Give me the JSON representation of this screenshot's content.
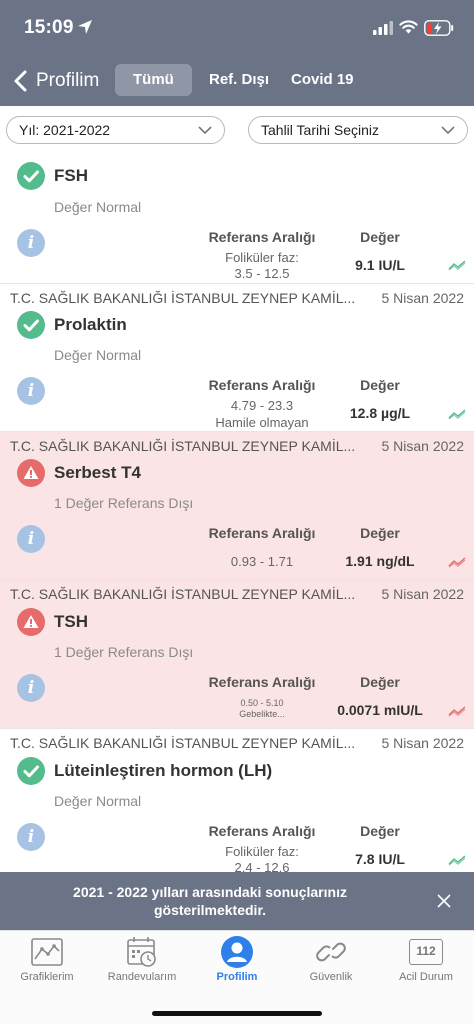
{
  "status_bar": {
    "time": "15:09"
  },
  "nav": {
    "back_label": "Profilim",
    "segments": [
      {
        "label": "Tümü",
        "active": true
      },
      {
        "label": "Ref. Dışı",
        "active": false
      },
      {
        "label": "Covid 19",
        "active": false
      }
    ]
  },
  "filters": {
    "year_select": "Yıl: 2021-2022",
    "date_select": "Tahlil Tarihi Seçiniz"
  },
  "results": {
    "ref_header": "Referans Aralığı",
    "value_header": "Değer",
    "items": [
      {
        "source": "",
        "date": "",
        "name": "FSH",
        "status": "Değer Normal",
        "abnormal": false,
        "ref_lines": [
          "Foliküler faz:",
          "3.5 - 12.5"
        ],
        "value": "9.1 IU/L"
      },
      {
        "source": "T.C. SAĞLIK BAKANLIĞI İSTANBUL ZEYNEP KAMİL...",
        "date": "5 Nisan 2022",
        "name": "Prolaktin",
        "status": "Değer Normal",
        "abnormal": false,
        "ref_lines": [
          "4.79 - 23.3",
          "Hamile olmayan"
        ],
        "value": "12.8 µg/L"
      },
      {
        "source": "T.C. SAĞLIK BAKANLIĞI İSTANBUL ZEYNEP KAMİL...",
        "date": "5 Nisan 2022",
        "name": "Serbest T4",
        "status": "1 Değer Referans Dışı",
        "abnormal": true,
        "ref_lines": [
          "0.93 - 1.71"
        ],
        "value": "1.91 ng/dL"
      },
      {
        "source": "T.C. SAĞLIK BAKANLIĞI İSTANBUL ZEYNEP KAMİL...",
        "date": "5 Nisan 2022",
        "name": "TSH",
        "status": "1 Değer Referans Dışı",
        "abnormal": true,
        "ref_lines": [
          "0.50 - 5.10",
          "Gebelikte..."
        ],
        "value": "0.0071 mIU/L"
      },
      {
        "source": "T.C. SAĞLIK BAKANLIĞI İSTANBUL ZEYNEP KAMİL...",
        "date": "5 Nisan 2022",
        "name": "Lüteinleştiren hormon (LH)",
        "status": "Değer Normal",
        "abnormal": false,
        "ref_lines": [
          "Foliküler faz:",
          "2.4 - 12.6"
        ],
        "value": "7.8 IU/L"
      }
    ]
  },
  "toast": {
    "message": "2021 - 2022 yılları arasındaki sonuçlarınız gösterilmektedir."
  },
  "tabbar": {
    "tabs": [
      {
        "label": "Grafiklerim",
        "icon": "chart-icon",
        "active": false
      },
      {
        "label": "Randevularım",
        "icon": "calendar-clock-icon",
        "active": false
      },
      {
        "label": "Profilim",
        "icon": "profile-icon",
        "active": true
      },
      {
        "label": "Güvenlik",
        "icon": "link-icon",
        "active": false
      },
      {
        "label": "Acil Durum",
        "icon": "emergency-112-icon",
        "active": false
      }
    ],
    "emergency_number": "112"
  },
  "colors": {
    "header_bg": "#6b7487",
    "normal_green": "#53bb8c",
    "alert_red": "#e66b6b",
    "alert_row_bg": "#fbe4e5",
    "info_blue": "#a7c3e4",
    "active_tab_blue": "#2f7fe8"
  }
}
